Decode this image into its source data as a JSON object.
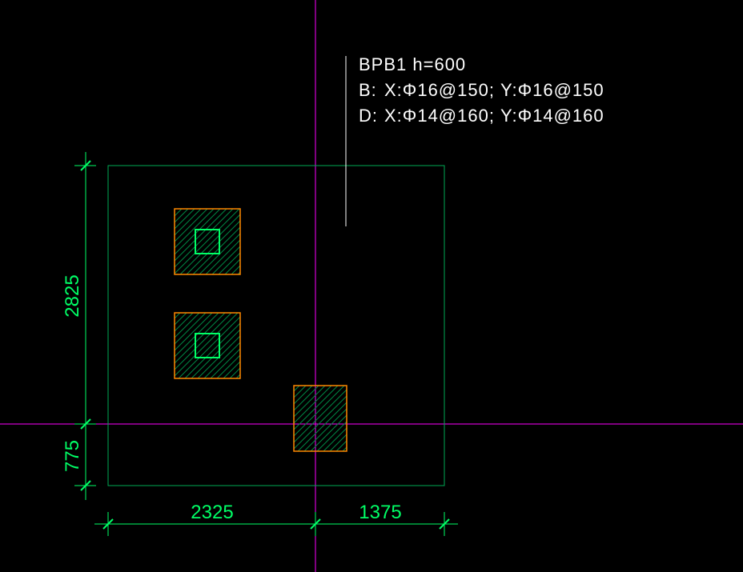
{
  "title": {
    "name": "BPB1 h=600"
  },
  "rebar": {
    "B": {
      "label": "B:",
      "X": "X:Φ16@150;",
      "Y": "Y:Φ16@150"
    },
    "D": {
      "label": "D:",
      "X": "X:Φ14@160;",
      "Y": "Y:Φ14@160"
    }
  },
  "dims": {
    "left_top": "2825",
    "left_bottom": "775",
    "bottom_left": "2325",
    "bottom_right": "1375"
  },
  "colors": {
    "bg": "#000000",
    "cross": "#ff00ff",
    "outline": "#00aa55",
    "dim": "#00ff66",
    "pile": "#ff8800",
    "text": "#ffffff"
  }
}
